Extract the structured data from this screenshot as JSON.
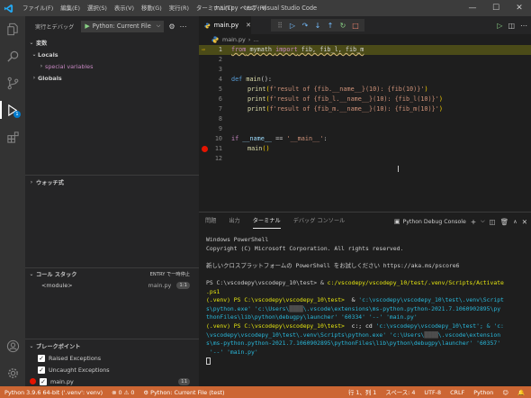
{
  "window": {
    "title": "main.py - test - Visual Studio Code",
    "menu": [
      "ファイル(F)",
      "編集(E)",
      "選択(S)",
      "表示(V)",
      "移動(G)",
      "実行(R)",
      "ターミナル(T)",
      "ヘルプ(H)"
    ],
    "controls": [
      "—",
      "☐",
      "✕"
    ]
  },
  "activity_bar": {
    "items": [
      "explorer-icon",
      "search-icon",
      "run-debug-icon",
      "extensions-icon"
    ],
    "debug_badge": "1",
    "bottom": [
      "account-icon",
      "settings-gear-icon"
    ]
  },
  "sidebar": {
    "header_label": "実行とデバッグ",
    "config": "Python: Current File",
    "variables": {
      "title": "変数",
      "locals": "Locals",
      "special": "special variables",
      "globals": "Globals"
    },
    "watch_title": "ウォッチ式",
    "callstack": {
      "title": "コール スタック",
      "status": "ENTRY で一時停止",
      "frame": "<module>",
      "file": "main.py",
      "line": "1:1"
    },
    "breakpoints": {
      "title": "ブレークポイント",
      "items": [
        "Raised Exceptions",
        "Uncaught Exceptions",
        "main.py"
      ],
      "line": "11"
    }
  },
  "editor": {
    "tab": "main.py",
    "breadcrumb": [
      "main.py",
      "..."
    ],
    "debug_toolbar": [
      "⠿",
      "▷",
      "↷",
      "↓",
      "↑",
      "↻",
      "□"
    ],
    "lines": {
      "l1": {
        "n": "1",
        "kw": "from",
        "mod": " mymath ",
        "imp": "import",
        "rest": " fib, fib_l, fib_m"
      },
      "l2": {
        "n": "2"
      },
      "l3": {
        "n": "3"
      },
      "l4": {
        "n": "4",
        "kw": "def",
        "name": " main",
        "rest": "():"
      },
      "l5": {
        "n": "5",
        "fn": "print",
        "code": "f'result of {fib.__name__}(10): {fib(10)}'"
      },
      "l6": {
        "n": "6",
        "fn": "print",
        "code": "f'result of {fib_l.__name__}(10): {fib_l(10)}'"
      },
      "l7": {
        "n": "7",
        "fn": "print",
        "code": "f'result of {fib_m.__name__}(10): {fib_m(10)}'"
      },
      "l8": {
        "n": "8"
      },
      "l9": {
        "n": "9"
      },
      "l10": {
        "n": "10",
        "kw": "if",
        "var": " __name__",
        "op": " == ",
        "str": "'__main__'",
        "rest": ":"
      },
      "l11": {
        "n": "11",
        "fn": "main",
        "rest": "()"
      },
      "l12": {
        "n": "12"
      }
    }
  },
  "panel": {
    "tabs": [
      "問題",
      "出力",
      "ターミナル",
      "デバッグ コンソール"
    ],
    "active_tab": "ターミナル",
    "terminal_select": "Python Debug Console",
    "terminal": {
      "t1": "Windows PowerShell",
      "t2": "Copyright (C) Microsoft Corporation. All rights reserved.",
      "t3": "新しいクロスプラットフォームの PowerShell をお試しください https://aka.ms/pscore6",
      "t4a": "PS C:\\vscodepy\\vscodepy_10\\test> & ",
      "t4b": "c:/vscodepy/vscodepy_10/test/.venv/Scripts/Activate",
      "t5": ".ps1",
      "t6a": "(.venv) PS C:\\vscodepy\\vscodepy_10\\test> ",
      "t6b": " & ",
      "t6c": "'c:\\vscodepy\\vscodepy_10\\test\\.venv\\Script",
      "t7": "s\\python.exe' 'c:\\Users\\",
      "t7b": "\\.vscode\\extensions\\ms-python.python-2021.7.1060902895\\py",
      "t8": "thonFiles\\lib\\python\\debugpy\\launcher' '60334' '--' 'main.py'",
      "t9a": "(.venv) PS C:\\vscodepy\\vscodepy_10\\test> ",
      "t9b": " c:; cd ",
      "t9c": "'c:\\vscodepy\\vscodepy_10\\test'; & 'c:",
      "t10": "\\vscodepy\\vscodepy_10\\test\\.venv\\Scripts\\python.exe' 'c:\\Users\\",
      "t10b": "\\.vscode\\extension",
      "t11": "s\\ms-python.python-2021.7.1060902895\\pythonFiles\\lib\\python\\debugpy\\launcher' '60357'",
      "t12": " '--' 'main.py'"
    }
  },
  "statusbar": {
    "interpreter": "Python 3.9.6 64-bit ('.venv': venv)",
    "problems": "⊗ 0 ⚠ 0",
    "debug_config": "Python: Current File (test)",
    "position": "行 1、列 1",
    "spaces": "スペース: 4",
    "encoding": "UTF-8",
    "eol": "CRLF",
    "language": "Python"
  },
  "colors": {
    "statusbar": "#cc6633",
    "activity": "#333333",
    "sidebar": "#252526",
    "editor": "#1e1e1e",
    "current_line": "#4b4b18",
    "breakpoint": "#e51400"
  }
}
